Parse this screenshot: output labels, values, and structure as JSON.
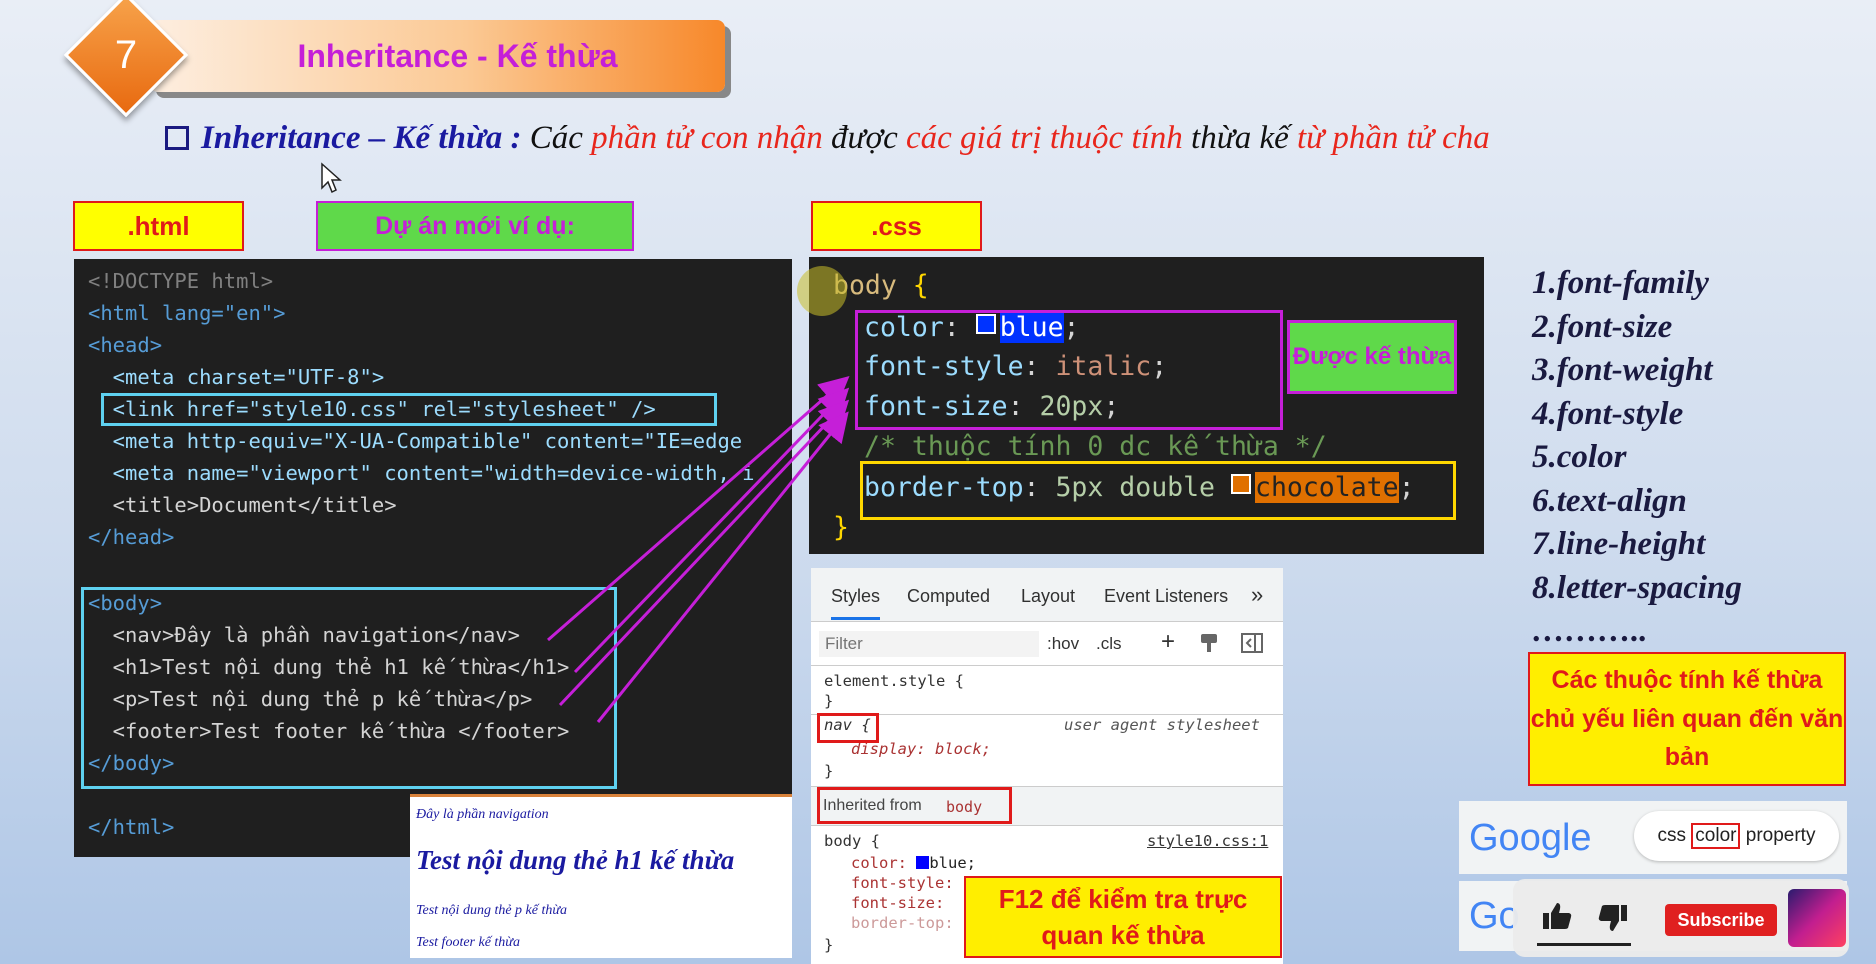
{
  "header": {
    "badge": "7",
    "title": "Inheritance - Kế thừa"
  },
  "definition": {
    "part1": "Inheritance – Kế thừa : ",
    "part2": "Các ",
    "part3": "phần tử con nhận",
    "part4": " được ",
    "part5": "các giá trị thuộc tính",
    "part6": " thừa kế ",
    "part7": "từ phần tử cha"
  },
  "labels": {
    "html": ".html",
    "project": "Dự án mới ví dụ:",
    "css": ".css",
    "inherited": "Được kế thừa",
    "main_props": "Các thuộc tính kế thừa chủ yếu liên quan đến văn bản",
    "f12": "F12 để kiểm tra trực quan kế thừa"
  },
  "html_code": [
    "<!DOCTYPE html>",
    "<html lang=\"en\">",
    "<head>",
    "  <meta charset=\"UTF-8\">",
    "  <link href=\"style10.css\" rel=\"stylesheet\" />",
    "  <meta http-equiv=\"X-UA-Compatible\" content=\"IE=edge",
    "  <meta name=\"viewport\" content=\"width=device-width, i",
    "  <title>Document</title>",
    "</head>",
    "",
    "<body>",
    "  <nav>Đây là phần navigation</nav>",
    "  <h1>Test nội dung thẻ h1 kế thừa</h1>",
    "  <p>Test nội dung thẻ p kế thừa</p>",
    "  <footer>Test footer kế thừa </footer>",
    "</body>",
    "",
    "</html>"
  ],
  "css_code": {
    "selector": "body",
    "open": "{",
    "color_prop": "color",
    "color_val": "blue",
    "style_prop": "font-style",
    "style_val": "italic",
    "size_prop": "font-size",
    "size_val": "20px",
    "comment": "/* thuộc tính 0 dc kế thừa */",
    "border_prop": "border-top",
    "border_val": "5px double",
    "border_color": "chocolate",
    "close": "}"
  },
  "properties": [
    "1.font-family",
    "2.font-size",
    "3.font-weight",
    "4.font-style",
    "5.color",
    "6.text-align",
    "7.line-height",
    "8.letter-spacing",
    "……….."
  ],
  "devtools": {
    "tabs": [
      "Styles",
      "Computed",
      "Layout",
      "Event Listeners",
      "»"
    ],
    "filter_placeholder": "Filter",
    "hov": ":hov",
    "cls": ".cls",
    "element_style": "element.style {",
    "close_brace": "}",
    "nav_selector": "nav {",
    "user_agent": "user agent stylesheet",
    "nav_rule": "display: block;",
    "inherited_label": "Inherited from",
    "inherited_from": "body",
    "body_selector": "body {",
    "source": "style10.css:1",
    "rule_color": "color:",
    "rule_color_val": "blue;",
    "rule_style": "font-style:",
    "rule_size": "font-size:",
    "rule_border": "border-top:"
  },
  "preview": {
    "nav": "Đây là phần navigation",
    "h1": "Test nội dung thẻ h1 kế thừa",
    "p": "Test nội dung thẻ p kế thừa",
    "footer": "Test footer kế thừa"
  },
  "google": {
    "logo": "Google",
    "search_pre": "css ",
    "search_word": "color",
    "search_post": " property",
    "logo2": "Go"
  },
  "youtube": {
    "subscribe": "Subscribe",
    "like_icon": "thumbs-up-icon",
    "dislike_icon": "thumbs-down-icon"
  },
  "colors": {
    "accent_magenta": "#c51fd8",
    "label_yellow": "#ffff00",
    "label_green": "#5fd94a",
    "red_text": "#e8261c",
    "cyan_box": "#5ed1f0"
  }
}
